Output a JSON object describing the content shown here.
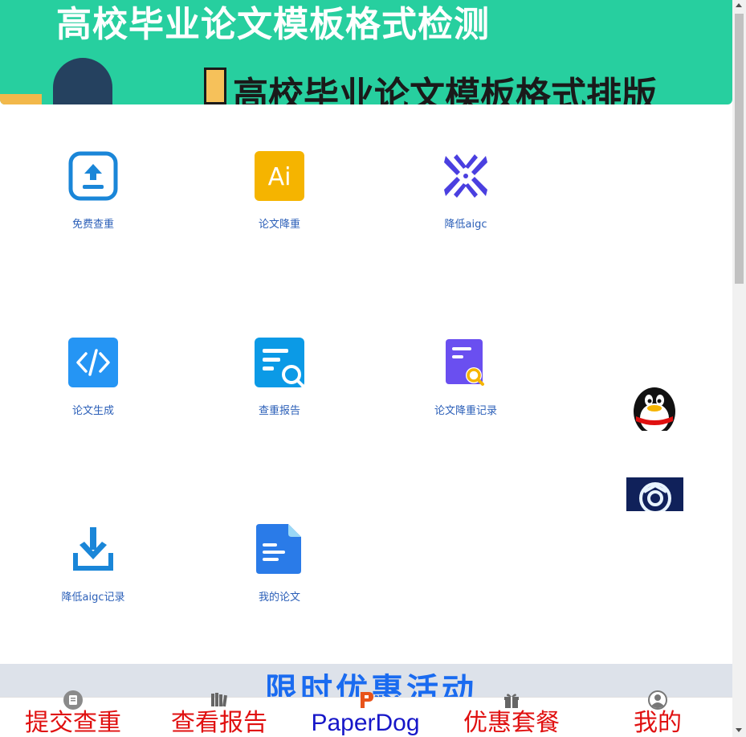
{
  "banner": {
    "title": "高校毕业论文模板格式检测",
    "subtitle": "高校毕业论文模板格式排版"
  },
  "grid": [
    {
      "label": "免费查重",
      "icon": "upload-icon"
    },
    {
      "label": "论文降重",
      "icon": "ai-icon"
    },
    {
      "label": "降低aigc",
      "icon": "aigc-x-icon"
    },
    {
      "label": "论文生成",
      "icon": "code-icon"
    },
    {
      "label": "查重报告",
      "icon": "report-search-icon"
    },
    {
      "label": "论文降重记录",
      "icon": "record-search-icon"
    },
    {
      "label": "降低aigc记录",
      "icon": "download-icon"
    },
    {
      "label": "我的论文",
      "icon": "document-icon"
    }
  ],
  "side": {
    "qq_icon": "qq-penguin-icon",
    "gpt_icon": "openai-icon"
  },
  "promo": {
    "text": "限时优惠活动"
  },
  "tabbar": [
    {
      "label": "提交查重",
      "icon": "clipboard-icon"
    },
    {
      "label": "查看报告",
      "icon": "books-icon"
    },
    {
      "label": "PaperDog",
      "icon": "paperdog-logo-icon"
    },
    {
      "label": "优惠套餐",
      "icon": "gift-icon"
    },
    {
      "label": "我的",
      "icon": "user-icon"
    }
  ],
  "colors": {
    "banner_bg": "#27cf9f",
    "link_blue": "#2b5fb8",
    "tab_red": "#e01010",
    "promo_blue": "#1a6bf0"
  }
}
